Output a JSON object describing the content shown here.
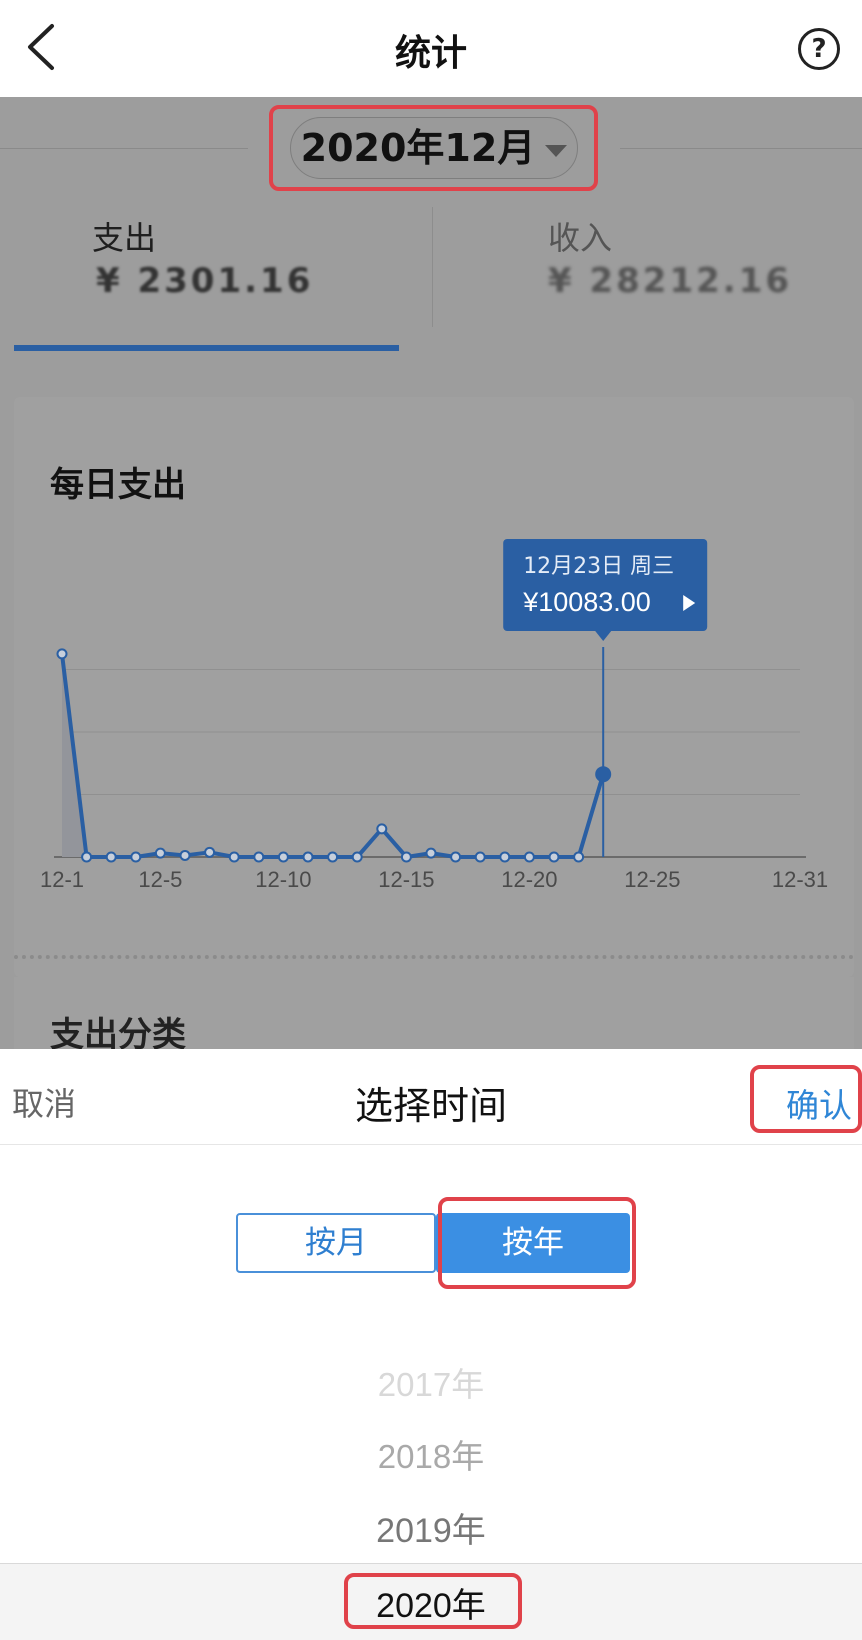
{
  "nav": {
    "title": "统计",
    "help_glyph": "?",
    "back_icon": "chevron-left-icon",
    "help_icon": "question-circle-icon"
  },
  "period": {
    "label": "2020年12月"
  },
  "tabs": [
    {
      "label": "支出",
      "amount": "¥ 2301.16"
    },
    {
      "label": "收入",
      "amount": "¥ 28212.16"
    }
  ],
  "daily": {
    "title": "每日支出"
  },
  "category": {
    "title": "支出分类"
  },
  "chart_data": {
    "type": "line",
    "title": "每日支出",
    "x": [
      1,
      2,
      3,
      4,
      5,
      6,
      7,
      8,
      9,
      10,
      11,
      12,
      13,
      14,
      15,
      16,
      17,
      18,
      19,
      20,
      21,
      22,
      23
    ],
    "values": [
      13000,
      0,
      0,
      0,
      250,
      100,
      300,
      0,
      0,
      0,
      0,
      0,
      0,
      1800,
      0,
      250,
      0,
      0,
      0,
      0,
      0,
      0,
      5300
    ],
    "tick_labels": [
      "12-1",
      "12-5",
      "12-10",
      "12-15",
      "12-20",
      "12-25",
      "12-31"
    ],
    "tick_days": [
      1,
      5,
      10,
      15,
      20,
      25,
      31
    ],
    "xlim": [
      1,
      31
    ],
    "ylim": [
      0,
      16000
    ],
    "grid": true,
    "tooltip": {
      "day": 23,
      "date": "12月23日 周三",
      "value": "¥10083.00"
    },
    "line_color": "#2a5fa3"
  },
  "sheet": {
    "cancel": "取消",
    "title": "选择时间",
    "confirm": "确认",
    "seg_month": "按月",
    "seg_year": "按年",
    "years": [
      "2017年",
      "2018年",
      "2019年",
      "2020年"
    ]
  },
  "colors": {
    "accent": "#3b8fe3",
    "highlight": "#e0424a",
    "dim": "#9d9d9d"
  }
}
